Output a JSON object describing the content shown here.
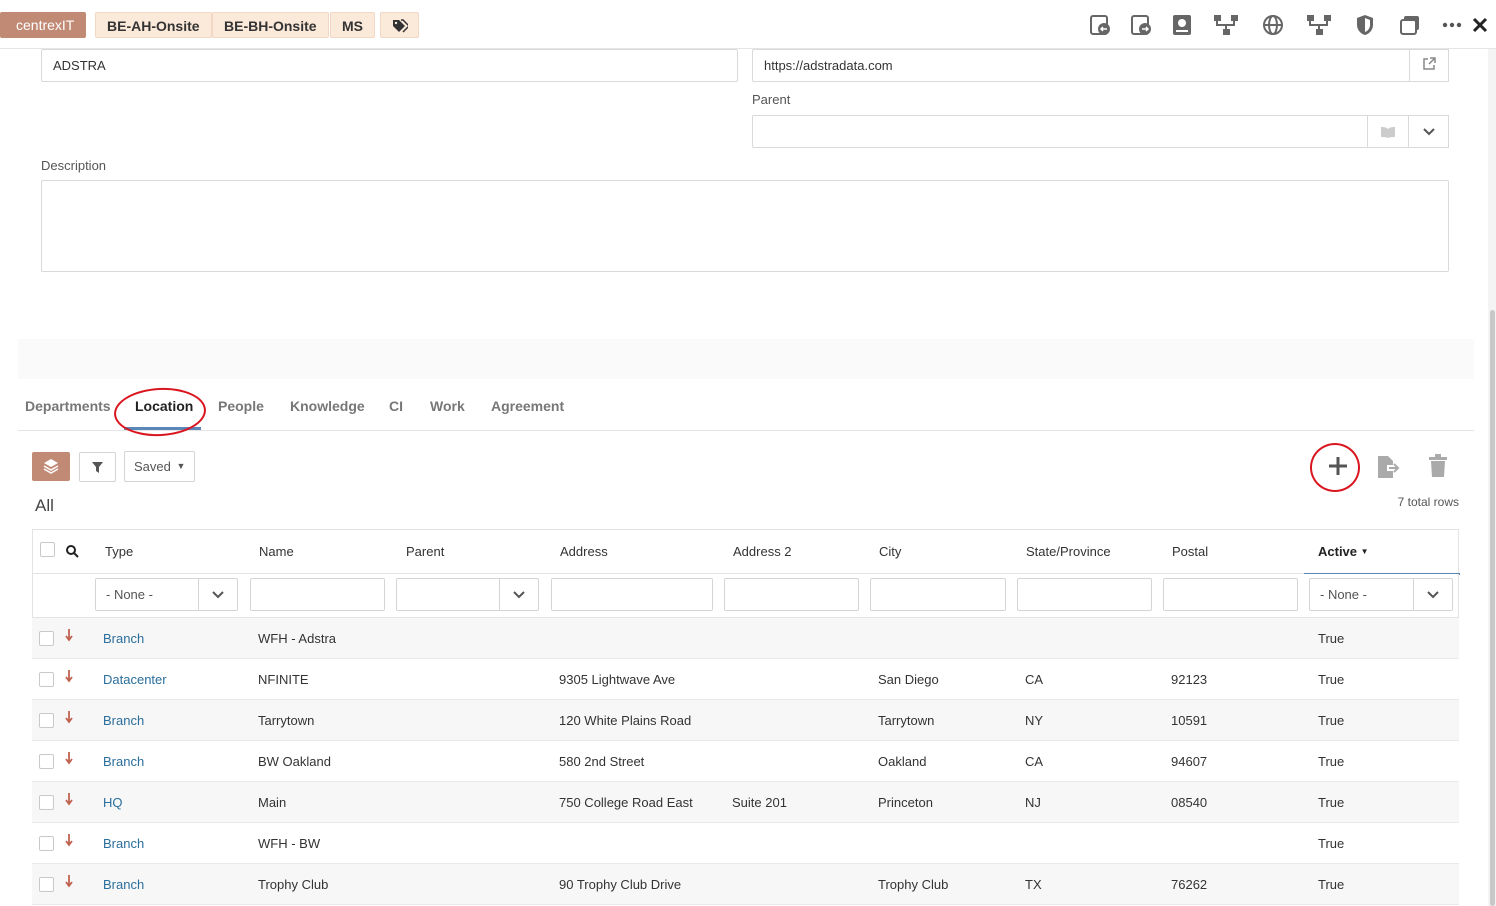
{
  "header": {
    "tags": [
      "centrexIT",
      "BE-AH-Onsite",
      "BE-BH-Onsite",
      "MS"
    ],
    "tag_icon": "tag-icon",
    "toolbar_icons": [
      "reply-icon",
      "redo-icon",
      "book-icon",
      "tree-icon",
      "globe-icon",
      "tree-icon",
      "shield-icon",
      "window-icon",
      "more-icon"
    ],
    "close_icon": "close-icon"
  },
  "form": {
    "name_value": "ADSTRA",
    "website_value": "https://adstradata.com",
    "parent_label": "Parent",
    "parent_value": "",
    "description_label": "Description",
    "description_value": ""
  },
  "tabs": [
    {
      "label": "Departments"
    },
    {
      "label": "Location"
    },
    {
      "label": "People"
    },
    {
      "label": "Knowledge"
    },
    {
      "label": "CI"
    },
    {
      "label": "Work"
    },
    {
      "label": "Agreement"
    }
  ],
  "toolbar": {
    "saved_label": "Saved",
    "view_label": "All",
    "total_rows": "7 total rows"
  },
  "table": {
    "columns": [
      "Type",
      "Name",
      "Parent",
      "Address",
      "Address 2",
      "City",
      "State/Province",
      "Postal",
      "Active"
    ],
    "type_filter": "- None -",
    "active_filter": "- None -",
    "rows": [
      {
        "type": "Branch",
        "name": "WFH - Adstra",
        "parent": "",
        "address": "",
        "address2": "",
        "city": "",
        "state": "",
        "postal": "",
        "active": "True"
      },
      {
        "type": "Datacenter",
        "name": "NFINITE",
        "parent": "",
        "address": "9305 Lightwave Ave",
        "address2": "",
        "city": "San Diego",
        "state": "CA",
        "postal": "92123",
        "active": "True"
      },
      {
        "type": "Branch",
        "name": "Tarrytown",
        "parent": "",
        "address": "120 White Plains Road",
        "address2": "",
        "city": "Tarrytown",
        "state": "NY",
        "postal": "10591",
        "active": "True"
      },
      {
        "type": "Branch",
        "name": "BW Oakland",
        "parent": "",
        "address": "580 2nd Street",
        "address2": "",
        "city": "Oakland",
        "state": "CA",
        "postal": "94607",
        "active": "True"
      },
      {
        "type": "HQ",
        "name": "Main",
        "parent": "",
        "address": "750 College Road East",
        "address2": "Suite 201",
        "city": "Princeton",
        "state": "NJ",
        "postal": "08540",
        "active": "True"
      },
      {
        "type": "Branch",
        "name": "WFH - BW",
        "parent": "",
        "address": "",
        "address2": "",
        "city": "",
        "state": "",
        "postal": "",
        "active": "True"
      },
      {
        "type": "Branch",
        "name": "Trophy Club",
        "parent": "",
        "address": "90 Trophy Club Drive",
        "address2": "",
        "city": "Trophy Club",
        "state": "TX",
        "postal": "76262",
        "active": "True"
      }
    ]
  }
}
